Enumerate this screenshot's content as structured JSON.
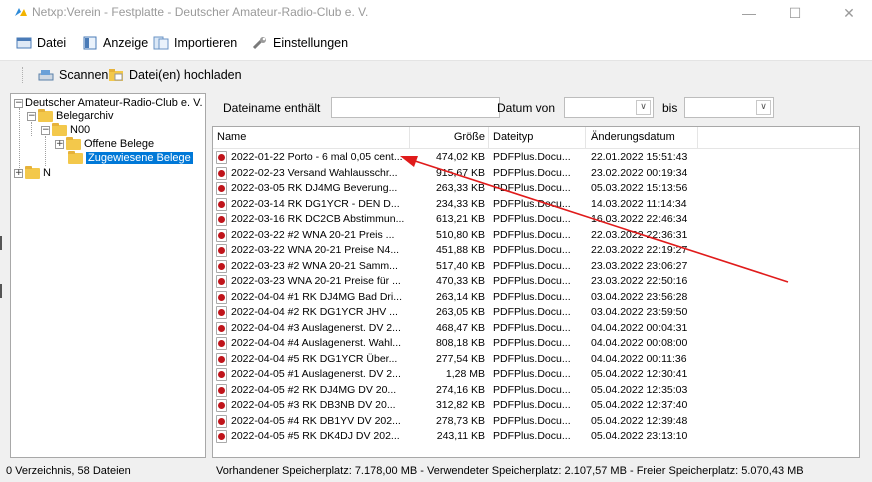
{
  "window": {
    "title": "Netxp:Verein - Festplatte - Deutscher Amateur-Radio-Club e. V.",
    "icon": "app-icon",
    "minimize_glyph": "—",
    "maximize_glyph": "☐",
    "close_glyph": "✕"
  },
  "menu": {
    "items": [
      {
        "label": "Datei",
        "icon": "file-menu-icon"
      },
      {
        "label": "Anzeige",
        "icon": "view-icon"
      },
      {
        "label": "Importieren",
        "icon": "import-icon"
      },
      {
        "label": "Einstellungen",
        "icon": "wrench-icon"
      }
    ]
  },
  "toolbar": {
    "scan_label": "Scannen",
    "upload_label": "Datei(en) hochladen"
  },
  "tree": {
    "root": "Deutscher Amateur-Radio-Club e. V.",
    "archive": "Belegarchiv",
    "n00": "N00",
    "open": "Offene Belege",
    "assigned": "Zugewiesene Belege",
    "n": "N"
  },
  "filter": {
    "name_label": "Dateiname enthält",
    "name_value": "",
    "date_from_label": "Datum von",
    "date_from_value": "",
    "date_to_label": "bis",
    "date_to_value": ""
  },
  "table": {
    "columns": [
      "Name",
      "Größe",
      "Dateityp",
      "Änderungsdatum"
    ],
    "rows": [
      [
        "2022-01-22 Porto - 6 mal 0,05 cent...",
        "474,02 KB",
        "PDFPlus.Docu...",
        "22.01.2022 15:51:43"
      ],
      [
        "2022-02-23 Versand Wahlausschr...",
        "915,67 KB",
        "PDFPlus.Docu...",
        "23.02.2022 00:19:34"
      ],
      [
        "2022-03-05 RK DJ4MG Beverung...",
        "263,33 KB",
        "PDFPlus.Docu...",
        "05.03.2022 15:13:56"
      ],
      [
        "2022-03-14 RK DG1YCR - DEN D...",
        "234,33 KB",
        "PDFPlus.Docu...",
        "14.03.2022 11:14:34"
      ],
      [
        "2022-03-16 RK DC2CB Abstimmun...",
        "613,21 KB",
        "PDFPlus.Docu...",
        "16.03.2022 22:46:34"
      ],
      [
        "2022-03-22 #2 WNA 20-21 Preis ...",
        "510,80 KB",
        "PDFPlus.Docu...",
        "22.03.2022 22:36:31"
      ],
      [
        "2022-03-22 WNA 20-21 Preise N4...",
        "451,88 KB",
        "PDFPlus.Docu...",
        "22.03.2022 22:19:27"
      ],
      [
        "2022-03-23 #2 WNA 20-21 Samm...",
        "517,40 KB",
        "PDFPlus.Docu...",
        "23.03.2022 23:06:27"
      ],
      [
        "2022-03-23 WNA 20-21 Preise für ...",
        "470,33 KB",
        "PDFPlus.Docu...",
        "23.03.2022 22:50:16"
      ],
      [
        "2022-04-04 #1 RK DJ4MG Bad Dri...",
        "263,14 KB",
        "PDFPlus.Docu...",
        "03.04.2022 23:56:28"
      ],
      [
        "2022-04-04 #2 RK DG1YCR JHV ...",
        "263,05 KB",
        "PDFPlus.Docu...",
        "03.04.2022 23:59:50"
      ],
      [
        "2022-04-04 #3 Auslagenerst. DV 2...",
        "468,47 KB",
        "PDFPlus.Docu...",
        "04.04.2022 00:04:31"
      ],
      [
        "2022-04-04 #4 Auslagenerst. Wahl...",
        "808,18 KB",
        "PDFPlus.Docu...",
        "04.04.2022 00:08:00"
      ],
      [
        "2022-04-04 #5 RK DG1YCR Über...",
        "277,54 KB",
        "PDFPlus.Docu...",
        "04.04.2022 00:11:36"
      ],
      [
        "2022-04-05 #1 Auslagenerst. DV 2...",
        "1,28 MB",
        "PDFPlus.Docu...",
        "05.04.2022 12:30:41"
      ],
      [
        "2022-04-05 #2 RK DJ4MG DV 20...",
        "274,16 KB",
        "PDFPlus.Docu...",
        "05.04.2022 12:35:03"
      ],
      [
        "2022-04-05 #3 RK DB3NB DV 20...",
        "312,82 KB",
        "PDFPlus.Docu...",
        "05.04.2022 12:37:40"
      ],
      [
        "2022-04-05 #4 RK DB1YV DV 202...",
        "278,73 KB",
        "PDFPlus.Docu...",
        "05.04.2022 12:39:48"
      ],
      [
        "2022-04-05 #5 RK DK4DJ DV 202...",
        "243,11 KB",
        "PDFPlus.Docu...",
        "05.04.2022 23:13:10"
      ]
    ]
  },
  "status": {
    "left": "0 Verzeichnis, 58 Dateien",
    "right": "Vorhandener Speicherplatz: 7.178,00 MB  -  Verwendeter Speicherplatz: 2.107,57 MB  -  Freier Speicherplatz: 5.070,43 MB"
  },
  "colors": {
    "selection": "#0078d7",
    "annotation_arrow": "#e01b1b",
    "folder": "#f3c84b",
    "pdf_icon": "#c0141b"
  }
}
